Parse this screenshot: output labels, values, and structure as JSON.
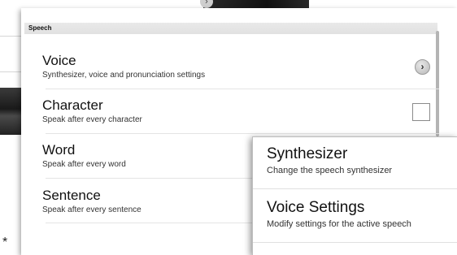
{
  "section": {
    "header": "Speech"
  },
  "rows": [
    {
      "title": "Voice",
      "subtitle": "Synthesizer, voice and pronunciation settings",
      "control": "chevron-icon"
    },
    {
      "title": "Character",
      "subtitle": "Speak after every character",
      "control": "checkbox",
      "checked": false
    },
    {
      "title": "Word",
      "subtitle": "Speak after every word"
    },
    {
      "title": "Sentence",
      "subtitle": "Speak after every sentence"
    }
  ],
  "popup": {
    "items": [
      {
        "title": "Synthesizer",
        "subtitle": "Change the speech synthesizer"
      },
      {
        "title": "Voice Settings",
        "subtitle": "Modify settings for the active speech"
      }
    ]
  },
  "background": {
    "asterisk": "*"
  },
  "colors": {
    "section_header_bg": "#e5e5e5",
    "text": "#111111",
    "subtext": "#333333",
    "scrollbar": "#b4b4b4"
  }
}
